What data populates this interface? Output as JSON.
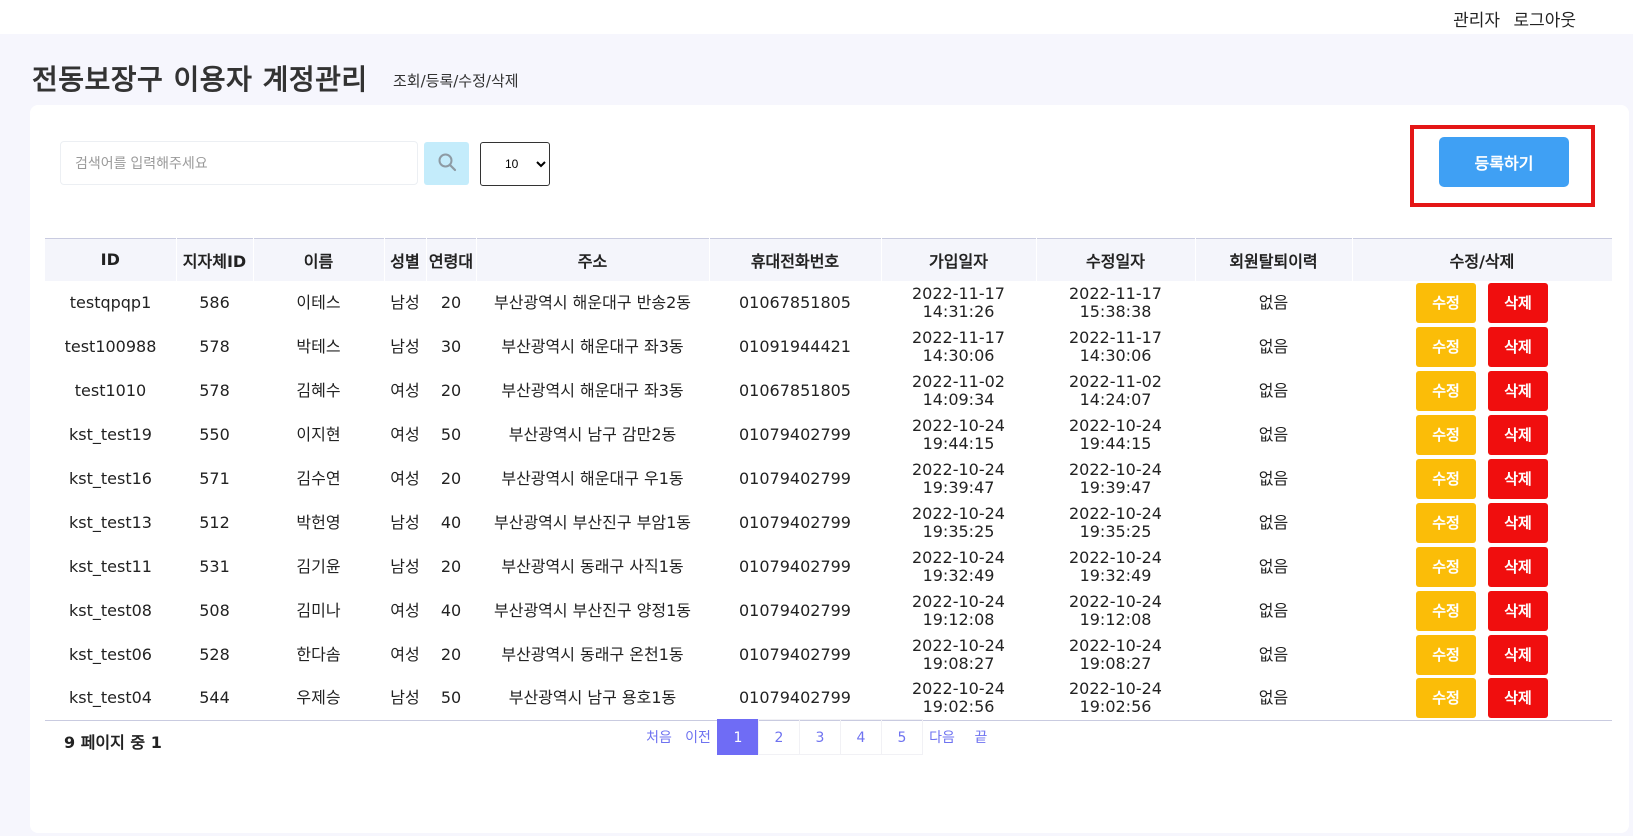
{
  "header": {
    "admin_label": "관리자",
    "logout_label": "로그아웃"
  },
  "page": {
    "title": "전동보장구 이용자 계정관리",
    "subtitle": "조회/등록/수정/삭제"
  },
  "search": {
    "placeholder": "검색어를 입력해주세요",
    "icon": "search-icon",
    "page_size": "10",
    "page_size_options": [
      "10"
    ]
  },
  "register_button": "등록하기",
  "table": {
    "columns": [
      "ID",
      "지자체ID",
      "이름",
      "성별",
      "연령대",
      "주소",
      "휴대전화번호",
      "가입일자",
      "수정일자",
      "회원탈퇴이력",
      "수정/삭제"
    ],
    "edit_label": "수정",
    "delete_label": "삭제",
    "rows": [
      {
        "id": "testqpqp1",
        "region_id": "586",
        "name": "이테스",
        "gender": "남성",
        "age": "20",
        "address": "부산광역시 해운대구 반송2동",
        "phone": "01067851805",
        "joined_date": "2022-11-17",
        "joined_time": "14:31:26",
        "modified_date": "2022-11-17",
        "modified_time": "15:38:38",
        "withdrawal": "없음"
      },
      {
        "id": "test100988",
        "region_id": "578",
        "name": "박테스",
        "gender": "남성",
        "age": "30",
        "address": "부산광역시 해운대구 좌3동",
        "phone": "01091944421",
        "joined_date": "2022-11-17",
        "joined_time": "14:30:06",
        "modified_date": "2022-11-17",
        "modified_time": "14:30:06",
        "withdrawal": "없음"
      },
      {
        "id": "test1010",
        "region_id": "578",
        "name": "김혜수",
        "gender": "여성",
        "age": "20",
        "address": "부산광역시 해운대구 좌3동",
        "phone": "01067851805",
        "joined_date": "2022-11-02",
        "joined_time": "14:09:34",
        "modified_date": "2022-11-02",
        "modified_time": "14:24:07",
        "withdrawal": "없음"
      },
      {
        "id": "kst_test19",
        "region_id": "550",
        "name": "이지현",
        "gender": "여성",
        "age": "50",
        "address": "부산광역시 남구 감만2동",
        "phone": "01079402799",
        "joined_date": "2022-10-24",
        "joined_time": "19:44:15",
        "modified_date": "2022-10-24",
        "modified_time": "19:44:15",
        "withdrawal": "없음"
      },
      {
        "id": "kst_test16",
        "region_id": "571",
        "name": "김수연",
        "gender": "여성",
        "age": "20",
        "address": "부산광역시 해운대구 우1동",
        "phone": "01079402799",
        "joined_date": "2022-10-24",
        "joined_time": "19:39:47",
        "modified_date": "2022-10-24",
        "modified_time": "19:39:47",
        "withdrawal": "없음"
      },
      {
        "id": "kst_test13",
        "region_id": "512",
        "name": "박헌영",
        "gender": "남성",
        "age": "40",
        "address": "부산광역시 부산진구 부암1동",
        "phone": "01079402799",
        "joined_date": "2022-10-24",
        "joined_time": "19:35:25",
        "modified_date": "2022-10-24",
        "modified_time": "19:35:25",
        "withdrawal": "없음"
      },
      {
        "id": "kst_test11",
        "region_id": "531",
        "name": "김기윤",
        "gender": "남성",
        "age": "20",
        "address": "부산광역시 동래구 사직1동",
        "phone": "01079402799",
        "joined_date": "2022-10-24",
        "joined_time": "19:32:49",
        "modified_date": "2022-10-24",
        "modified_time": "19:32:49",
        "withdrawal": "없음"
      },
      {
        "id": "kst_test08",
        "region_id": "508",
        "name": "김미나",
        "gender": "여성",
        "age": "40",
        "address": "부산광역시 부산진구 양정1동",
        "phone": "01079402799",
        "joined_date": "2022-10-24",
        "joined_time": "19:12:08",
        "modified_date": "2022-10-24",
        "modified_time": "19:12:08",
        "withdrawal": "없음"
      },
      {
        "id": "kst_test06",
        "region_id": "528",
        "name": "한다솜",
        "gender": "여성",
        "age": "20",
        "address": "부산광역시 동래구 온천1동",
        "phone": "01079402799",
        "joined_date": "2022-10-24",
        "joined_time": "19:08:27",
        "modified_date": "2022-10-24",
        "modified_time": "19:08:27",
        "withdrawal": "없음"
      },
      {
        "id": "kst_test04",
        "region_id": "544",
        "name": "우제승",
        "gender": "남성",
        "age": "50",
        "address": "부산광역시 남구 용호1동",
        "phone": "01079402799",
        "joined_date": "2022-10-24",
        "joined_time": "19:02:56",
        "modified_date": "2022-10-24",
        "modified_time": "19:02:56",
        "withdrawal": "없음"
      }
    ]
  },
  "pagination": {
    "info": "9 페이지 중 1",
    "first": "처음",
    "prev": "이전",
    "pages": [
      "1",
      "2",
      "3",
      "4",
      "5"
    ],
    "current": "1",
    "next": "다음",
    "last": "끝"
  },
  "colors": {
    "register": "#3fa0f4",
    "edit": "#fbbd08",
    "delete": "#f00e0e",
    "active_page": "#6f6cf5",
    "highlight": "#e41616"
  }
}
